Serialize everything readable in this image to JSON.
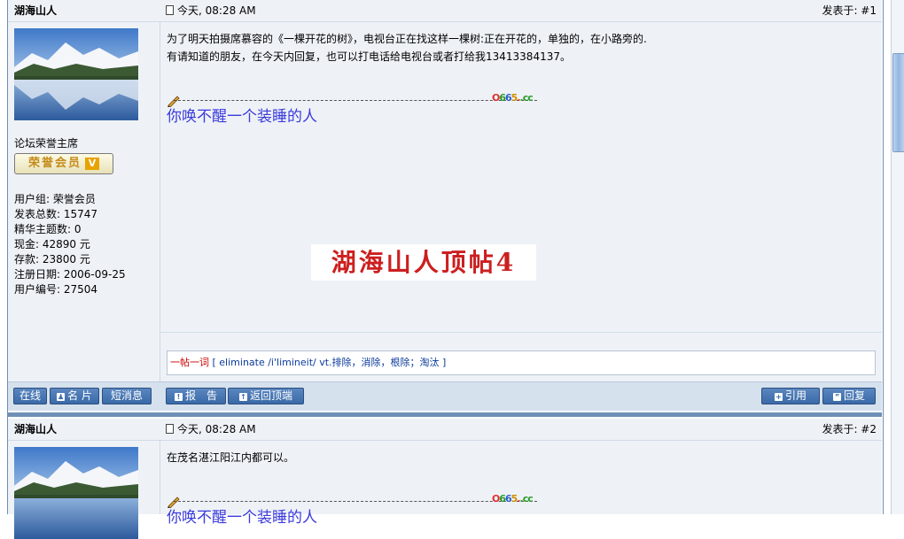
{
  "posts": [
    {
      "author": "湖海山人",
      "time": "今天, 08:28 AM",
      "floor": "发表于: #1",
      "rank_title": "论坛荣誉主席",
      "badge": "荣誉会员",
      "badge_mark": "V",
      "stats": [
        "用户组: 荣誉会员",
        "发表总数: 15747",
        "精华主题数: 0",
        "现金: 42890 元",
        "存款: 23800 元",
        "注册日期: 2006-09-25",
        "用户编号: 27504"
      ],
      "body": [
        "为了明天拍摄席慕容的《一棵开花的树》，电视台正在找这样一棵树:正在开花的，单独的，在小路旁的.",
        "有请知道的朋友，在今天内回复，也可以打电话给电视台或者打给我13413384137。"
      ],
      "signature": "你唤不醒一个装睡的人",
      "stamp": "湖海山人顶帖4",
      "word_label": "一帖一词",
      "word_def": "[ eliminate /i'limineit/ vt.排除，消除，根除；淘汰 ]"
    },
    {
      "author": "湖海山人",
      "time": "今天, 08:28 AM",
      "floor": "发表于: #2",
      "body": [
        "在茂名湛江阳江内都可以。"
      ],
      "signature": "你唤不醒一个装睡的人"
    }
  ],
  "sig_mark": [
    "O",
    "6",
    "6",
    "5",
    ".",
    ".cc"
  ],
  "actions": {
    "online": "在线",
    "card": "名 片",
    "pm": "短消息",
    "report": "报　告",
    "top": "返回顶端",
    "quote": "引用",
    "reply": "回复"
  },
  "colors": {
    "header_bg": "#eef2f7",
    "button": "#3a6aa8",
    "stamp": "#cc1f1f",
    "signature": "#3a3adc"
  }
}
